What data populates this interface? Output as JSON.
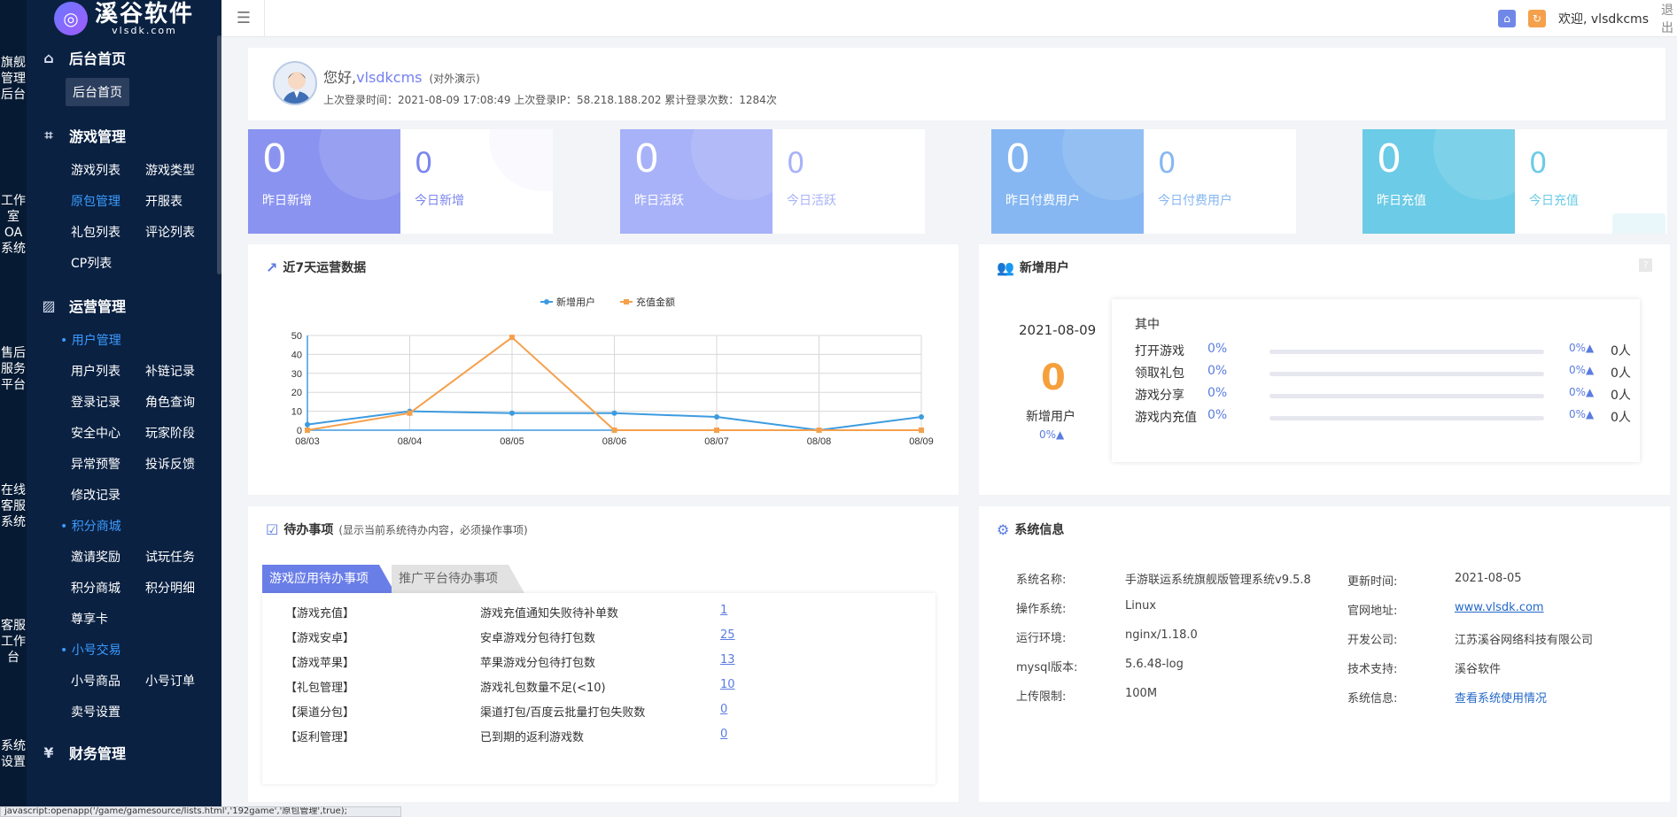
{
  "rail": [
    "旗舰管理后台",
    "工作室OA系统",
    "售后服务平台",
    "在线客服系统",
    "客服工作台",
    "系统设置"
  ],
  "logo": {
    "name": "溪谷软件",
    "domain": "vlsdk.com"
  },
  "sidebar": {
    "home": {
      "title": "后台首页",
      "active_item": "后台首页"
    },
    "game": {
      "title": "游戏管理",
      "items": [
        "游戏列表",
        "游戏类型",
        "原包管理",
        "开服表",
        "礼包列表",
        "评论列表",
        "CP列表"
      ]
    },
    "ops": {
      "title": "运营管理",
      "user_group": "用户管理",
      "user_items": [
        "用户列表",
        "补链记录",
        "登录记录",
        "角色查询",
        "安全中心",
        "玩家阶段",
        "异常预警",
        "投诉反馈",
        "修改记录"
      ],
      "points_group": "积分商城",
      "points_items": [
        "邀请奖励",
        "试玩任务",
        "积分商城",
        "积分明细",
        "尊享卡"
      ],
      "trade_group": "小号交易",
      "trade_items": [
        "小号商品",
        "小号订单",
        "卖号设置"
      ]
    },
    "finance": {
      "title": "财务管理"
    }
  },
  "topbar": {
    "welcome": "欢迎, vlsdkcms",
    "logout": "退出"
  },
  "greeting": {
    "hello": "您好,",
    "user": "vlsdkcms",
    "demo": "(对外演示)",
    "info": "上次登录时间：2021-08-09 17:08:49 上次登录IP：58.218.188.202 累计登录次数：1284次"
  },
  "stats": [
    {
      "y_value": "0",
      "y_label": "昨日新增",
      "t_value": "0",
      "t_label": "今日新增",
      "color": "#8a93f0",
      "tcolor": "#7b86ee"
    },
    {
      "y_value": "0",
      "y_label": "昨日活跃",
      "t_value": "0",
      "t_label": "今日活跃",
      "color": "#a8b2f8",
      "tcolor": "#a8b2f8"
    },
    {
      "y_value": "0",
      "y_label": "昨日付费用户",
      "t_value": "0",
      "t_label": "今日付费用户",
      "color": "#86b7f2",
      "tcolor": "#86b7f2"
    },
    {
      "y_value": "0",
      "y_label": "昨日充值",
      "t_value": "0",
      "t_label": "今日充值",
      "color": "#6ccbe6",
      "tcolor": "#6ccbe6"
    }
  ],
  "chart_panel": {
    "title": "近7天运营数据"
  },
  "chart_data": {
    "type": "line",
    "x": [
      "08/03",
      "08/04",
      "08/05",
      "08/06",
      "08/07",
      "08/08",
      "08/09"
    ],
    "series": [
      {
        "name": "新增用户",
        "color": "#3d9be0",
        "values": [
          3,
          10,
          9,
          9,
          7,
          0,
          7
        ]
      },
      {
        "name": "充值金额",
        "color": "#f5a04c",
        "values": [
          0,
          9,
          49,
          0,
          0,
          0,
          0
        ]
      }
    ],
    "ylim": [
      0,
      50
    ],
    "yticks": [
      0,
      10,
      20,
      30,
      40,
      50
    ],
    "grid": true,
    "legend": "top-center"
  },
  "new_users": {
    "title": "新增用户",
    "help": "?",
    "date": "2021-08-09",
    "count": "0",
    "label": "新增用户",
    "pct": "0%▲",
    "breakdown_title": "其中",
    "rows": [
      {
        "name": "打开游戏",
        "pct": "0%",
        "fill": 0,
        "pct2": "0%▲",
        "count": "0人"
      },
      {
        "name": "领取礼包",
        "pct": "0%",
        "fill": 0,
        "pct2": "0%▲",
        "count": "0人"
      },
      {
        "name": "游戏分享",
        "pct": "0%",
        "fill": 0,
        "pct2": "0%▲",
        "count": "0人"
      },
      {
        "name": "游戏内充值",
        "pct": "0%",
        "fill": 0,
        "pct2": "0%▲",
        "count": "0人"
      }
    ]
  },
  "todo": {
    "title": "待办事项",
    "note": "(显示当前系统待办内容，必须操作事项)",
    "tabs": [
      "游戏应用待办事项",
      "推广平台待办事项"
    ],
    "rows": [
      {
        "cat": "【游戏充值】",
        "desc": "游戏充值通知失败待补单数",
        "count": "1"
      },
      {
        "cat": "【游戏安卓】",
        "desc": "安卓游戏分包待打包数",
        "count": "25"
      },
      {
        "cat": "【游戏苹果】",
        "desc": "苹果游戏分包待打包数",
        "count": "13"
      },
      {
        "cat": "【礼包管理】",
        "desc": "游戏礼包数量不足(<10)",
        "count": "10"
      },
      {
        "cat": "【渠道分包】",
        "desc": "渠道打包/百度云批量打包失败数",
        "count": "0"
      },
      {
        "cat": "【返利管理】",
        "desc": "已到期的返利游戏数",
        "count": "0"
      }
    ]
  },
  "sysinfo": {
    "title": "系统信息",
    "left": [
      {
        "k": "系统名称:",
        "v": "手游联运系统旗舰版管理系统v9.5.8"
      },
      {
        "k": "操作系统:",
        "v": "Linux"
      },
      {
        "k": "运行环境:",
        "v": "nginx/1.18.0"
      },
      {
        "k": "mysql版本:",
        "v": "5.6.48-log"
      },
      {
        "k": "上传限制:",
        "v": "100M"
      }
    ],
    "right": [
      {
        "k": "更新时间:",
        "v": "2021-08-05"
      },
      {
        "k": "官网地址:",
        "v": "www.vlsdk.com"
      },
      {
        "k": "开发公司:",
        "v": "江苏溪谷网络科技有限公司"
      },
      {
        "k": "技术支持:",
        "v": "溪谷软件"
      },
      {
        "k": "系统信息:",
        "v": "查看系统使用情况"
      }
    ]
  },
  "statusbar": "javascript:openapp('/game/gamesource/lists.html','192game','原包管理',true);"
}
